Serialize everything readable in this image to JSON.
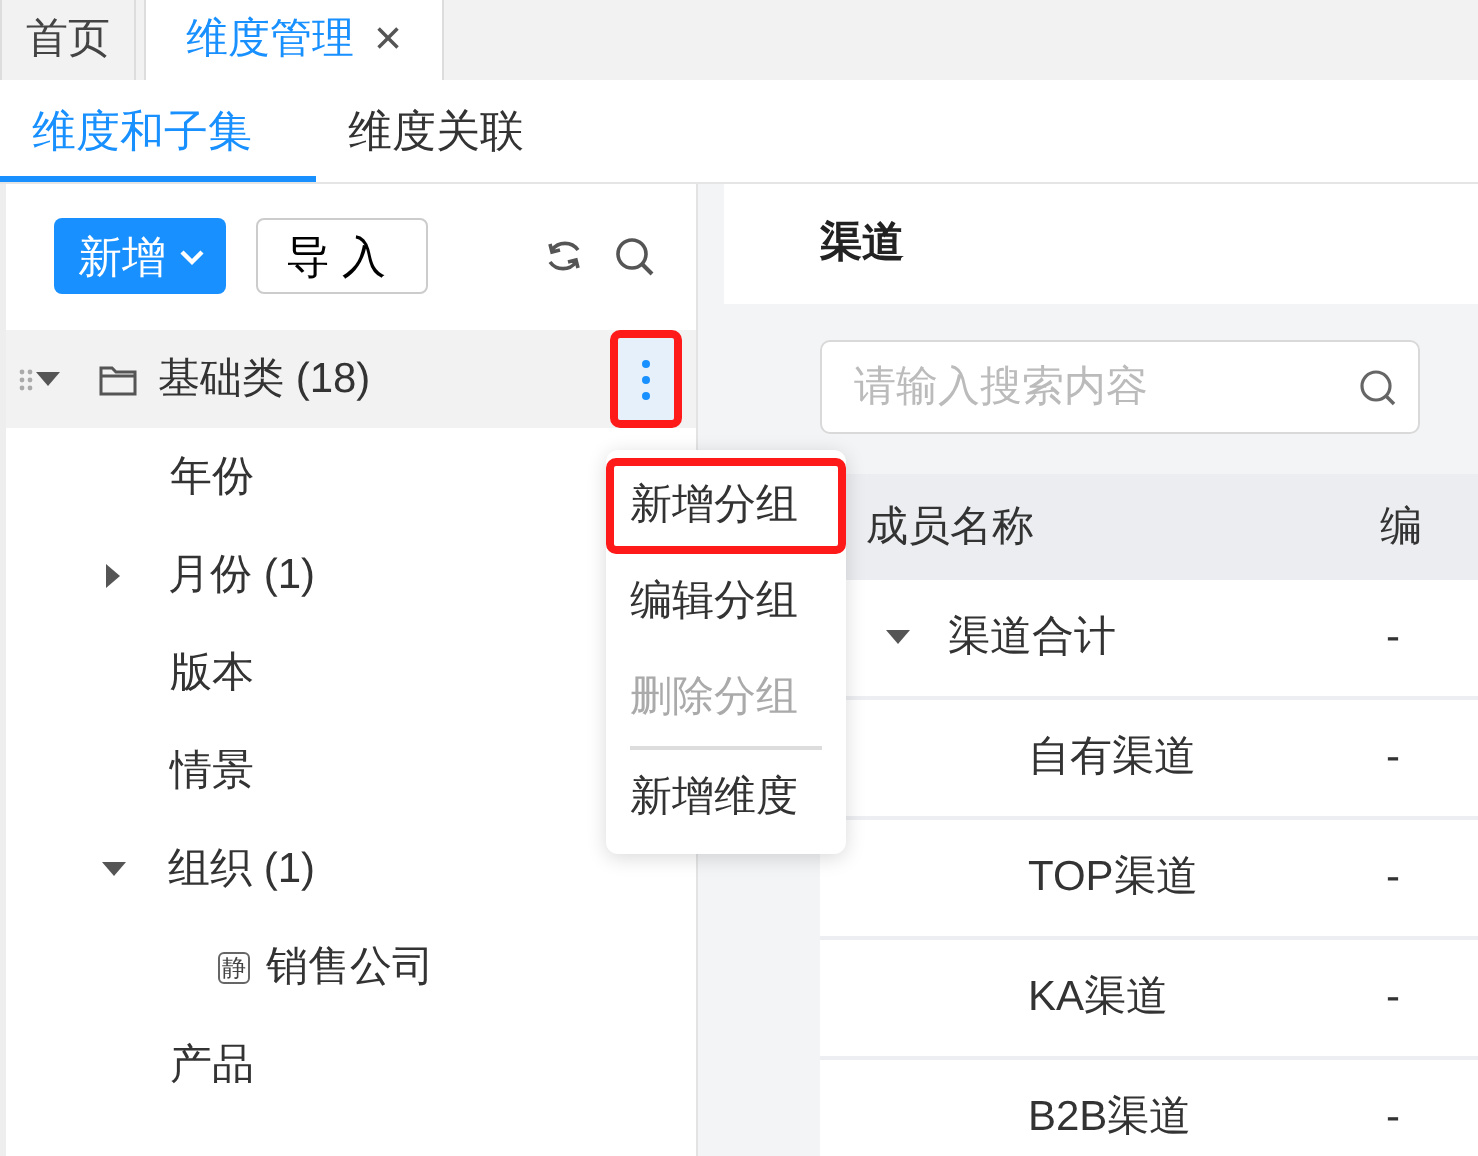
{
  "page_tabs": [
    {
      "label": "首页",
      "selected": false
    },
    {
      "label": "维度管理",
      "selected": true,
      "close": "×"
    }
  ],
  "sub_tabs": [
    {
      "label": "维度和子集",
      "selected": true
    },
    {
      "label": "维度关联",
      "selected": false
    }
  ],
  "toolbar": {
    "add_button": "新增",
    "import_button": "导入"
  },
  "tree": [
    {
      "label": "基础类 (18)",
      "kind": "folder",
      "expanded": true,
      "hovered": true,
      "children": [
        {
          "label": "年份",
          "kind": "leaf"
        },
        {
          "label": "月份 (1)",
          "kind": "group",
          "expanded": false
        },
        {
          "label": "版本",
          "kind": "leaf"
        },
        {
          "label": "情景",
          "kind": "leaf"
        },
        {
          "label": "组织 (1)",
          "kind": "group",
          "expanded": true,
          "children": [
            {
              "label": "销售公司",
              "kind": "static",
              "badge": "静"
            }
          ]
        },
        {
          "label": "产品",
          "kind": "leaf"
        }
      ]
    }
  ],
  "more_button": {
    "highlighted": true
  },
  "context_menu": [
    {
      "label": "新增分组",
      "disabled": false,
      "highlighted": true,
      "divider_before": false
    },
    {
      "label": "编辑分组",
      "disabled": false,
      "highlighted": false,
      "divider_before": false
    },
    {
      "label": "删除分组",
      "disabled": true,
      "highlighted": false,
      "divider_before": false
    },
    {
      "label": "新增维度",
      "disabled": false,
      "highlighted": false,
      "divider_before": true
    }
  ],
  "detail": {
    "title": "渠道",
    "search": {
      "placeholder": "请输入搜索内容"
    },
    "table": {
      "columns": [
        "成员名称",
        "编"
      ],
      "rows": [
        {
          "name": "渠道合计",
          "column_2": "-",
          "expanded": true,
          "children": [
            {
              "name": "自有渠道",
              "column_2": "-"
            },
            {
              "name": "TOP渠道",
              "column_2": "-"
            },
            {
              "name": "KA渠道",
              "column_2": "-"
            },
            {
              "name": "B2B渠道",
              "column_2": "-"
            }
          ]
        }
      ]
    }
  }
}
